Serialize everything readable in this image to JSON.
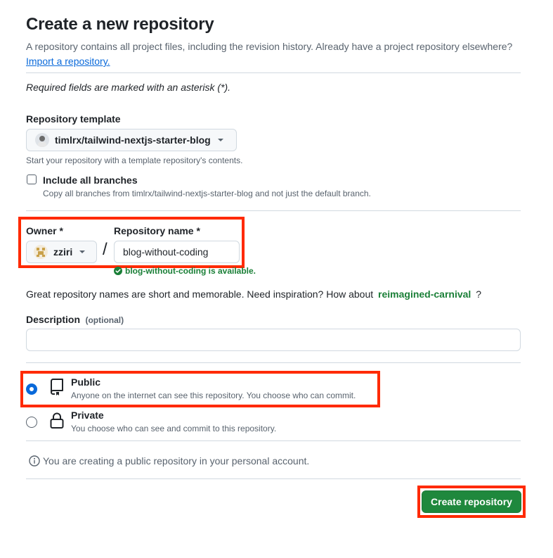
{
  "header": {
    "title": "Create a new repository",
    "intro_text": "A repository contains all project files, including the revision history. Already have a project repository elsewhere?",
    "import_link": "Import a repository."
  },
  "required_note": "Required fields are marked with an asterisk (*).",
  "template": {
    "label": "Repository template",
    "selected": "timlrx/tailwind-nextjs-starter-blog",
    "help": "Start your repository with a template repository's contents.",
    "include_branches_label": "Include all branches",
    "include_branches_checked": false,
    "include_branches_help": "Copy all branches from timlrx/tailwind-nextjs-starter-blog and not just the default branch."
  },
  "owner": {
    "label": "Owner *",
    "selected": "zziri"
  },
  "separator": "/",
  "repo_name": {
    "label": "Repository name *",
    "value": "blog-without-coding",
    "availability": "blog-without-coding is available."
  },
  "suggestion": {
    "text": "Great repository names are short and memorable. Need inspiration? How about",
    "name": "reimagined-carnival",
    "suffix": "?"
  },
  "description": {
    "label": "Description",
    "optional": "(optional)",
    "value": "",
    "placeholder": ""
  },
  "visibility": {
    "selected": "public",
    "public_label": "Public",
    "public_help": "Anyone on the internet can see this repository. You choose who can commit.",
    "private_label": "Private",
    "private_help": "You choose who can see and commit to this repository."
  },
  "info_text": "You are creating a public repository in your personal account.",
  "submit_label": "Create repository",
  "colors": {
    "accent_blue": "#0969da",
    "success_green": "#1a7f37",
    "primary_button": "#1f883d",
    "highlight_red": "#ff2a00"
  }
}
